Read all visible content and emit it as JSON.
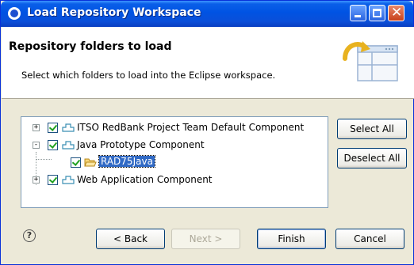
{
  "window": {
    "title": "Load Repository Workspace"
  },
  "header": {
    "title": "Repository folders to load",
    "subtitle": "Select which folders to load into the Eclipse workspace."
  },
  "tree": {
    "items": [
      {
        "label": "ITSO RedBank Project Team Default Component",
        "checked": true,
        "expander": "+",
        "icon": "component-icon"
      },
      {
        "label": "Java Prototype Component",
        "checked": true,
        "expander": "-",
        "icon": "component-icon"
      },
      {
        "label": "RAD75Java",
        "checked": true,
        "expander": "",
        "icon": "folder-icon",
        "selected": true
      },
      {
        "label": "Web Application Component",
        "checked": true,
        "expander": "+",
        "icon": "component-icon"
      }
    ]
  },
  "side_buttons": {
    "select_all": "Select All",
    "deselect_all": "Deselect All"
  },
  "footer": {
    "back": "< Back",
    "next": "Next >",
    "finish": "Finish",
    "cancel": "Cancel",
    "help": "?"
  },
  "colors": {
    "titlebar": "#0053e3",
    "selection": "#316ac5",
    "check": "#21a121"
  }
}
